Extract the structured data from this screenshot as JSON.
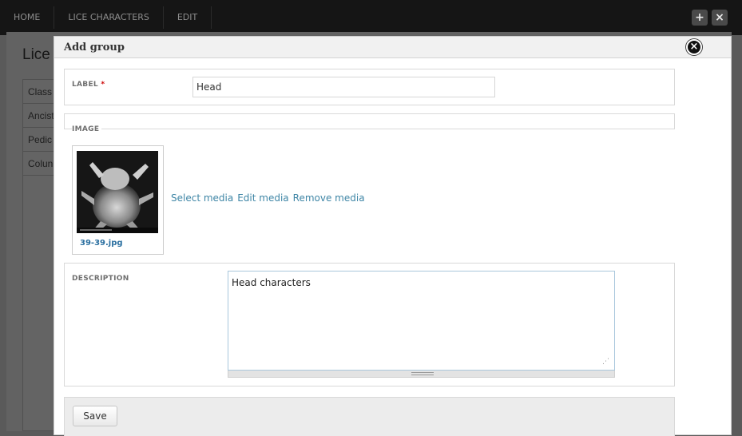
{
  "nav": {
    "items": [
      "HOME",
      "LICE CHARACTERS",
      "EDIT"
    ],
    "add_glyph": "+",
    "close_glyph": "×"
  },
  "background": {
    "page_title": "Lice",
    "rows": [
      "Class",
      "Ancist",
      "Pedic",
      "Colun"
    ]
  },
  "modal": {
    "title": "Add group",
    "close_glyph": "×",
    "label_field": {
      "label": "LABEL",
      "required_marker": "*",
      "value": "Head"
    },
    "image_section": {
      "legend": "IMAGE",
      "filename": "39-39.jpg",
      "links": [
        "Select media",
        "Edit media",
        "Remove media"
      ]
    },
    "description": {
      "label": "DESCRIPTION",
      "value": "Head characters",
      "grip_glyph": "⋰"
    },
    "save_label": "Save"
  }
}
